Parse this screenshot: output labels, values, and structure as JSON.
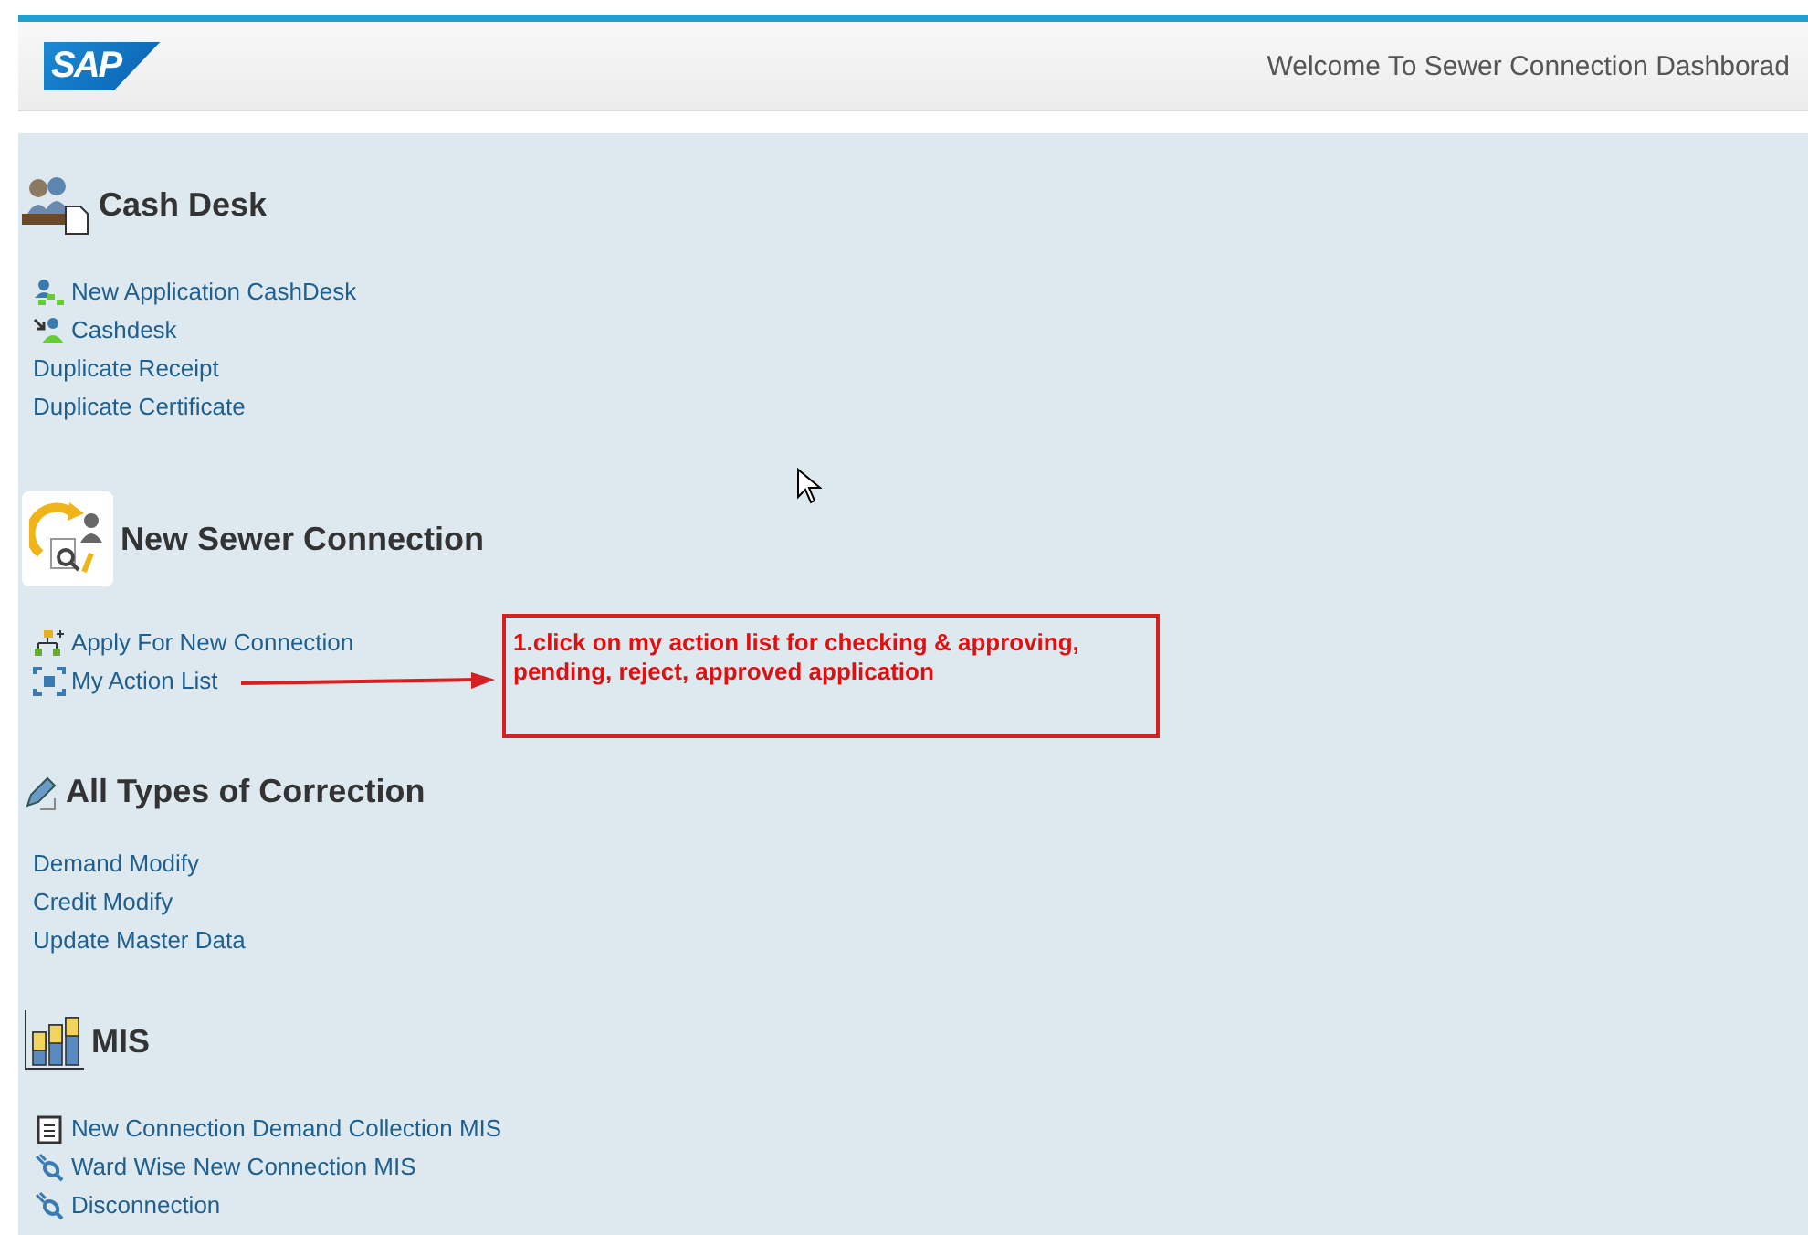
{
  "header": {
    "logo": "SAP",
    "title": "Welcome To Sewer Connection Dashborad"
  },
  "sections": [
    {
      "title": "Cash Desk",
      "kind": "people",
      "items": [
        {
          "label": "New Application CashDesk",
          "kind": "tree"
        },
        {
          "label": "Cashdesk",
          "kind": "arrow"
        },
        {
          "label": "Duplicate Receipt",
          "kind": "plain"
        },
        {
          "label": "Duplicate Certificate",
          "kind": "plain"
        }
      ]
    },
    {
      "title": "New Sewer Connection",
      "kind": "tile",
      "items": [
        {
          "label": "Apply For New Connection",
          "kind": "org"
        },
        {
          "label": "My Action List",
          "kind": "scan"
        }
      ]
    },
    {
      "title": "All Types of Correction",
      "kind": "pencil",
      "items": [
        {
          "label": "Demand Modify",
          "kind": "plain"
        },
        {
          "label": "Credit Modify",
          "kind": "plain"
        },
        {
          "label": "Update Master Data",
          "kind": "plain"
        }
      ]
    },
    {
      "title": "MIS",
      "kind": "chart",
      "items": [
        {
          "label": "New Connection Demand Collection MIS",
          "kind": "clipboard"
        },
        {
          "label": "Ward Wise New Connection MIS",
          "kind": "plug"
        },
        {
          "label": "Disconnection",
          "kind": "plug"
        }
      ]
    }
  ],
  "annotation": {
    "text": "1.click on my action list for checking & approving, pending, reject, approved application"
  }
}
